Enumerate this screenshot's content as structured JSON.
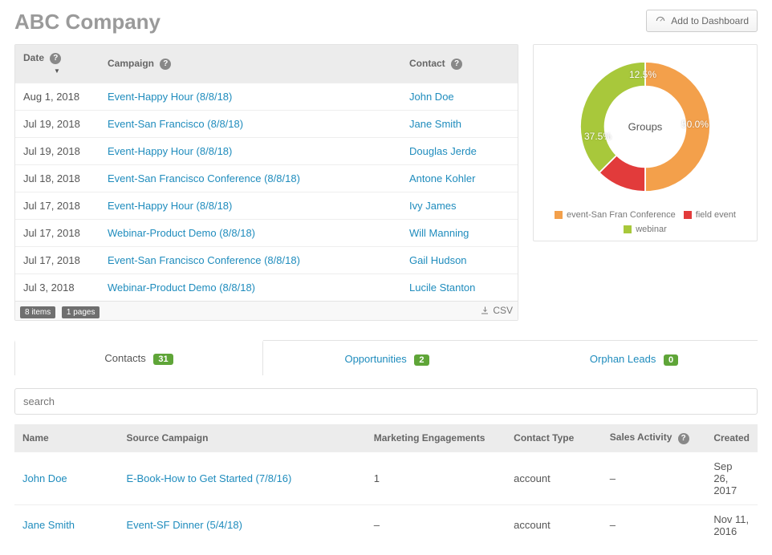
{
  "page_title": "ABC Company",
  "header_button": "Add to Dashboard",
  "table": {
    "headers": {
      "date": "Date",
      "campaign": "Campaign",
      "contact": "Contact"
    },
    "rows": [
      {
        "date": "Aug 1, 2018",
        "campaign": "Event-Happy Hour (8/8/18)",
        "contact": "John Doe"
      },
      {
        "date": "Jul 19, 2018",
        "campaign": "Event-San Francisco (8/8/18)",
        "contact": "Jane Smith"
      },
      {
        "date": "Jul 19, 2018",
        "campaign": "Event-Happy Hour (8/8/18)",
        "contact": "Douglas Jerde"
      },
      {
        "date": "Jul 18, 2018",
        "campaign": "Event-San Francisco Conference (8/8/18)",
        "contact": "Antone Kohler"
      },
      {
        "date": "Jul 17, 2018",
        "campaign": "Event-Happy Hour (8/8/18)",
        "contact": "Ivy James"
      },
      {
        "date": "Jul 17, 2018",
        "campaign": "Webinar-Product Demo (8/8/18)",
        "contact": "Will Manning"
      },
      {
        "date": "Jul 17, 2018",
        "campaign": "Event-San Francisco Conference (8/8/18)",
        "contact": "Gail Hudson"
      },
      {
        "date": "Jul 3, 2018",
        "campaign": "Webinar-Product Demo (8/8/18)",
        "contact": "Lucile Stanton"
      }
    ],
    "footer": {
      "items": "8 items",
      "pages": "1 pages",
      "csv": "CSV"
    }
  },
  "chart_data": {
    "type": "pie",
    "title": "Groups",
    "slices": [
      {
        "label": "event-San Fran Conference",
        "value": 50.0,
        "color": "#f3a04b",
        "display": "50.0%"
      },
      {
        "label": "field event",
        "value": 12.5,
        "color": "#e23b3b",
        "display": "12.5%"
      },
      {
        "label": "webinar",
        "value": 37.5,
        "color": "#a8c83b",
        "display": "37.5%"
      }
    ]
  },
  "tabs": {
    "contacts": {
      "label": "Contacts",
      "count": "31"
    },
    "opportunities": {
      "label": "Opportunities",
      "count": "2"
    },
    "orphans": {
      "label": "Orphan Leads",
      "count": "0"
    }
  },
  "search_placeholder": "search",
  "lower_table": {
    "headers": {
      "name": "Name",
      "source": "Source Campaign",
      "eng": "Marketing Engagements",
      "ctype": "Contact Type",
      "sales": "Sales Activity",
      "created": "Created"
    },
    "rows": [
      {
        "name": "John Doe",
        "source": "E-Book-How to Get Started (7/8/16)",
        "eng": "1",
        "ctype": "account",
        "sales": "–",
        "created": "Sep 26, 2017"
      },
      {
        "name": "Jane Smith",
        "source": "Event-SF Dinner (5/4/18)",
        "eng": "–",
        "ctype": "account",
        "sales": "–",
        "created": "Nov 11, 2016"
      }
    ]
  }
}
